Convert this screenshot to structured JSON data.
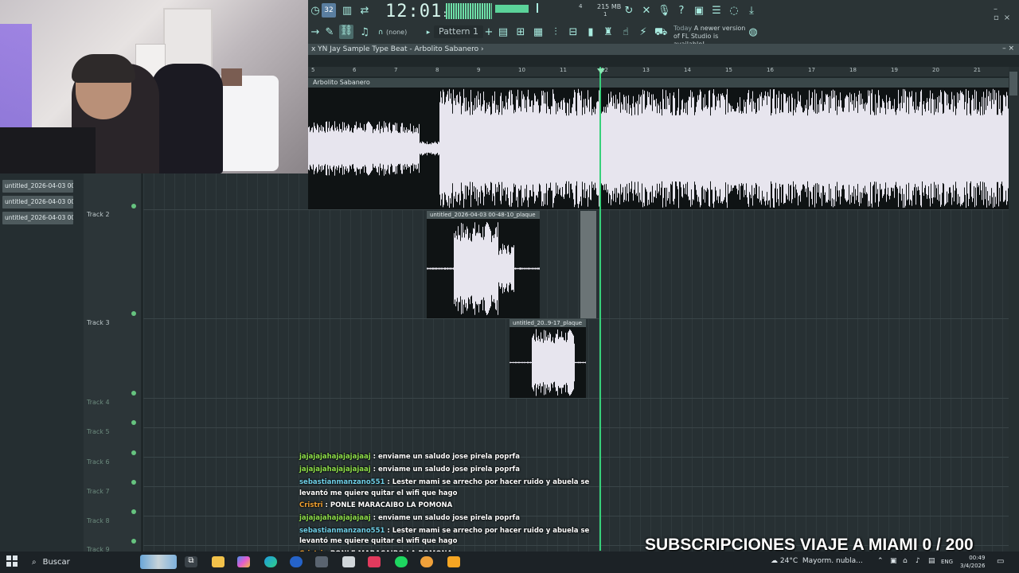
{
  "fl": {
    "clock_main": "12:01",
    "clock_sub": "06",
    "memory_label": "215 MB",
    "mem_top": "4",
    "mem_bottom": "1",
    "pattern_selector": "Pattern 1",
    "snap_value": "(none)",
    "news_prefix": "Today",
    "news_text": "A newer version of FL Studio is available!"
  },
  "playlist": {
    "title": "x YN Jay Sample Type Beat - Arbolito Sabanero ›",
    "ruler": [
      "5",
      "6",
      "7",
      "8",
      "9",
      "10",
      "11",
      "12",
      "13",
      "14",
      "15",
      "16",
      "17",
      "18",
      "19",
      "20",
      "21"
    ],
    "tracks": [
      {
        "label": "Track 2"
      },
      {
        "label": "Track 3"
      },
      {
        "label": "Track 4"
      },
      {
        "label": "Track 5"
      },
      {
        "label": "Track 6"
      },
      {
        "label": "Track 7"
      },
      {
        "label": "Track 8"
      },
      {
        "label": "Track 9"
      }
    ],
    "clips": {
      "main": "Arbolito Sabanero",
      "clip2": "untitled_2026-04-03 00-48-10_plaque",
      "clip3": "untitled_20..9-17_plaque"
    }
  },
  "left_panel": {
    "items": [
      "untitled_2026-04-03 00-...",
      "untitled_2026-04-03 00-...",
      "untitled_2026-04-03 00-..."
    ]
  },
  "chat": [
    {
      "user": "jajajajahajajajajaaj",
      "message": " : enviame un saludo jose pirela poprfa",
      "color": "green"
    },
    {
      "user": "jajajajahajajajajaaj",
      "message": " : enviame un saludo jose pirela poprfa",
      "color": "green"
    },
    {
      "user": "sebastianmanzano551",
      "message": " : Lester mami se arrecho por hacer ruido y abuela se",
      "color": "blue"
    },
    {
      "user": "",
      "message": "levantó me quiere quitar el wifi que hago",
      "color": ""
    },
    {
      "user": "Cristri",
      "message": " : PONLE MARACAIBO LA POMONA",
      "color": "orange"
    },
    {
      "user": "jajajajahajajajajaaj",
      "message": " : enviame un saludo jose pirela poprfa",
      "color": "green"
    },
    {
      "user": "sebastianmanzano551",
      "message": " : Lester mami se arrecho por hacer ruido y abuela se",
      "color": "blue"
    },
    {
      "user": "",
      "message": "levantó me quiere quitar el wifi que hago",
      "color": ""
    },
    {
      "user": "Cristri",
      "message": " : PONLE MARACAIBO LA POMONA",
      "color": "orange"
    },
    {
      "user": "jajajajahajajajajaaj",
      "message": " : enviame un saludo jose pirela poprfa",
      "color": "green"
    }
  ],
  "overlay": {
    "banner": "SUBSCRIPCIONES VIAJE A MIAMI 0 / 200"
  },
  "taskbar": {
    "search_placeholder": "Buscar",
    "temperature": "24°C",
    "weather_text": "Mayorm. nubla...",
    "language": "ENG",
    "time": "00:49",
    "date": "3/4/2026"
  },
  "colors": {
    "accent": "#37d07a",
    "toolbar_icons": "#a9ece0",
    "chat_green": "#8fe04a",
    "chat_blue": "#6fd0e8",
    "chat_orange": "#f0a030"
  }
}
